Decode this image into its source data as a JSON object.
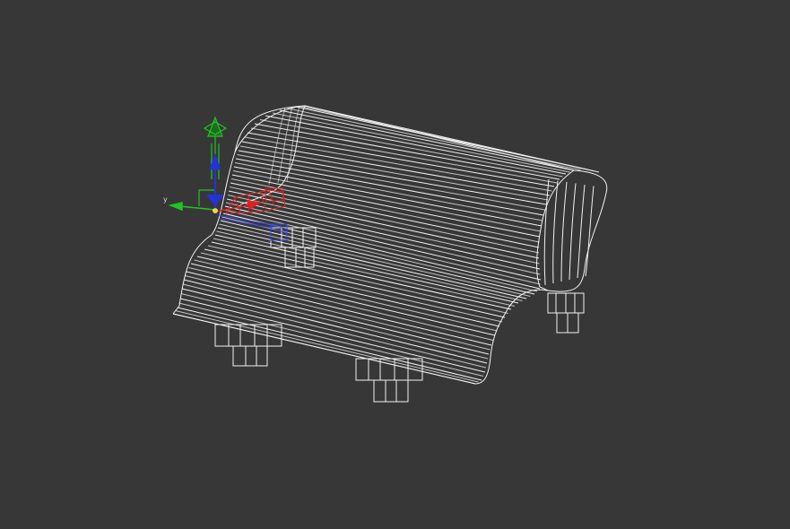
{
  "viewport": {
    "background": "#373737",
    "wire_color": "#f2f2f2"
  },
  "model": {
    "type": "wireframe",
    "object": "bench-seat-with-legs"
  },
  "gizmo": {
    "type": "move-transform-gizmo",
    "axes": [
      {
        "name": "x",
        "color": "#e02020",
        "label": ""
      },
      {
        "name": "y",
        "color": "#22c322",
        "label": "y"
      },
      {
        "name": "z",
        "color": "#2233dd",
        "label": ""
      }
    ],
    "plane_highlight_color": "#2a8f2a"
  }
}
